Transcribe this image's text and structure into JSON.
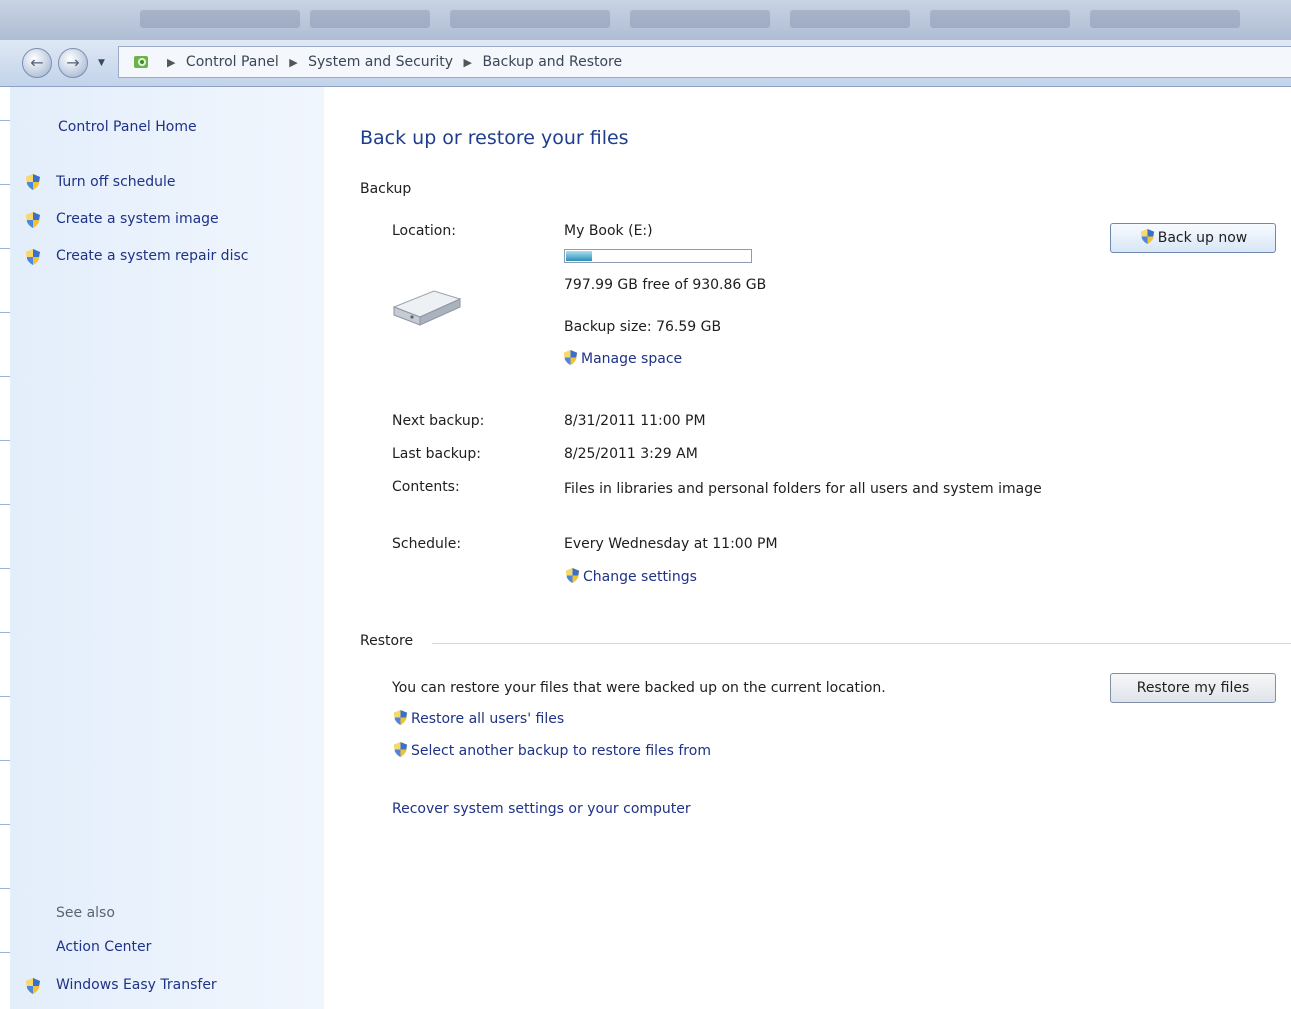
{
  "breadcrumb": {
    "items": [
      "Control Panel",
      "System and Security",
      "Backup and Restore"
    ]
  },
  "left_panel": {
    "home": "Control Panel Home",
    "tasks": [
      {
        "label": "Turn off schedule",
        "icon": "shield-icon"
      },
      {
        "label": "Create a system image",
        "icon": "shield-icon"
      },
      {
        "label": "Create a system repair disc",
        "icon": "shield-icon"
      }
    ],
    "see_also_heading": "See also",
    "see_also": [
      {
        "label": "Action Center"
      },
      {
        "label": "Windows Easy Transfer",
        "icon": "shield-icon"
      }
    ]
  },
  "main": {
    "title": "Back up or restore your files",
    "backup": {
      "heading": "Backup",
      "location_label": "Location:",
      "location_value": "My Book (E:)",
      "usage_fraction": 0.14,
      "free_space": "797.99 GB free of 930.86 GB",
      "backup_size": "Backup size: 76.59 GB",
      "manage_space": "Manage space",
      "back_up_now": "Back up now",
      "next_backup_label": "Next backup:",
      "next_backup_value": "8/31/2011 11:00 PM",
      "last_backup_label": "Last backup:",
      "last_backup_value": "8/25/2011 3:29 AM",
      "contents_label": "Contents:",
      "contents_value": "Files in libraries and personal folders for all users and system image",
      "schedule_label": "Schedule:",
      "schedule_value": "Every Wednesday at 11:00 PM",
      "change_settings": "Change settings"
    },
    "restore": {
      "heading": "Restore",
      "description": "You can restore your files that were backed up on the current location.",
      "restore_my_files": "Restore my files",
      "restore_all_users": "Restore all users' files",
      "select_another": "Select another backup to restore files from",
      "recover": "Recover system settings or your computer"
    }
  },
  "colors": {
    "link": "#1e3287",
    "title": "#1e3d8f",
    "left_panel_bg": "#e3eefb"
  }
}
